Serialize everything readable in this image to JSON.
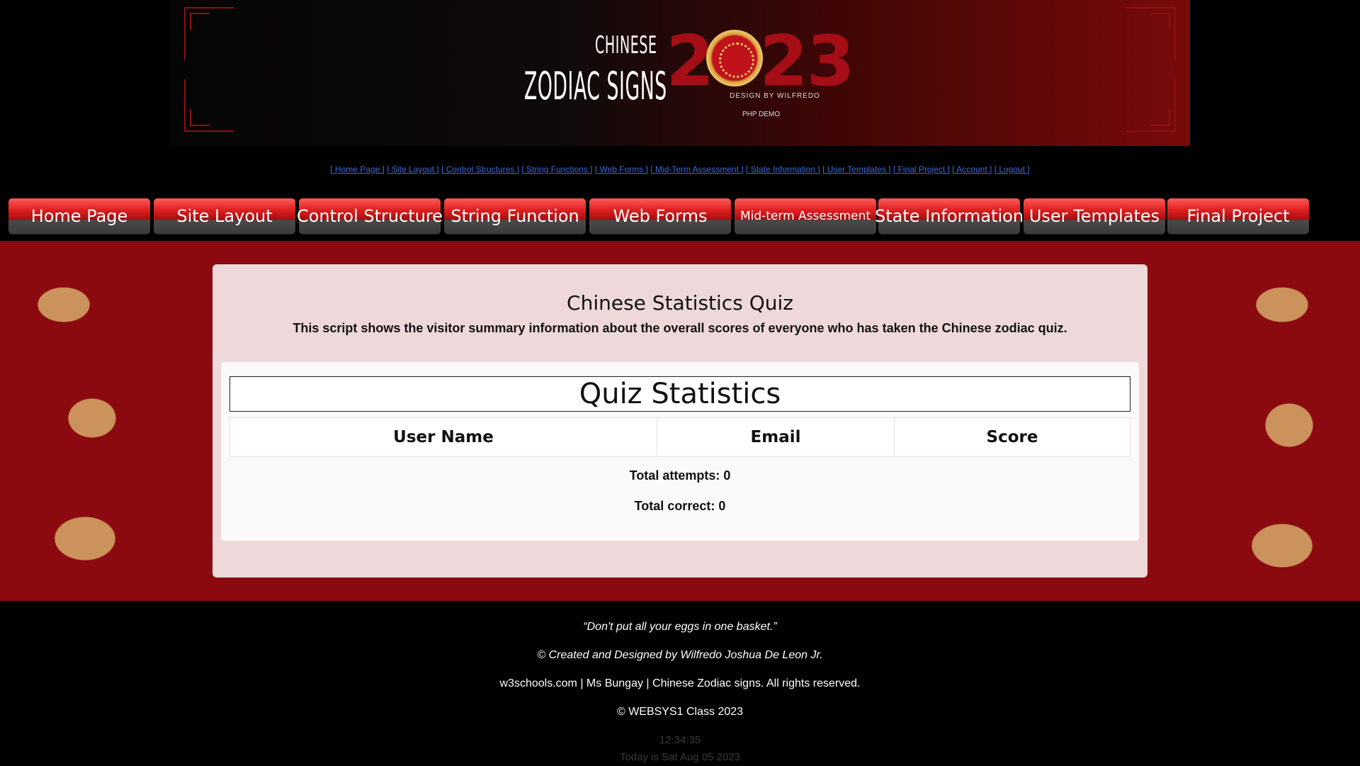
{
  "banner": {
    "line1": "CHINESE",
    "line2": "ZODIAC SIGNS",
    "year": "2023",
    "credit": "DESIGN BY WILFREDO",
    "php": "PHP DEMO"
  },
  "textlinks": [
    "[ Home Page ]",
    "[ Site Layout ]",
    "[ Control Structures ]",
    "[ String Functions ]",
    "[ Web Forms ]",
    "[ Mid-Term Assessment ]",
    "[ State Information ]",
    "[ User Templates ]",
    "[ Final Project ]",
    "[ Account ]",
    "[ Logout ]"
  ],
  "nav": [
    "Home Page",
    "Site Layout",
    "Control Structure",
    "String Function",
    "Web Forms",
    "Mid-term Assessment",
    "State Information",
    "User Templates",
    "Final Project"
  ],
  "content": {
    "title": "Chinese Statistics Quiz",
    "description": "This script shows the visitor summary information about the overall scores of everyone who has taken the Chinese zodiac quiz.",
    "stats_heading": "Quiz Statistics",
    "columns": [
      "User Name",
      "Email",
      "Score"
    ],
    "total_attempts": "Total attempts: 0",
    "total_correct": "Total correct: 0"
  },
  "footer": {
    "quote": "“Don't put all your eggs in one basket.”",
    "credit": "© Created and Designed by Wilfredo Joshua De Leon Jr.",
    "sites": "w3schools.com | Ms Bungay | Chinese Zodiac signs. All rights reserved.",
    "class": "© WEBSYS1 Class 2023",
    "time": "12:34:35",
    "today": "Today is Sat Aug 05 2023"
  },
  "colors": {
    "accent": "#a50e16",
    "backdrop": "#8b0a10",
    "link": "#3b6ad8"
  }
}
